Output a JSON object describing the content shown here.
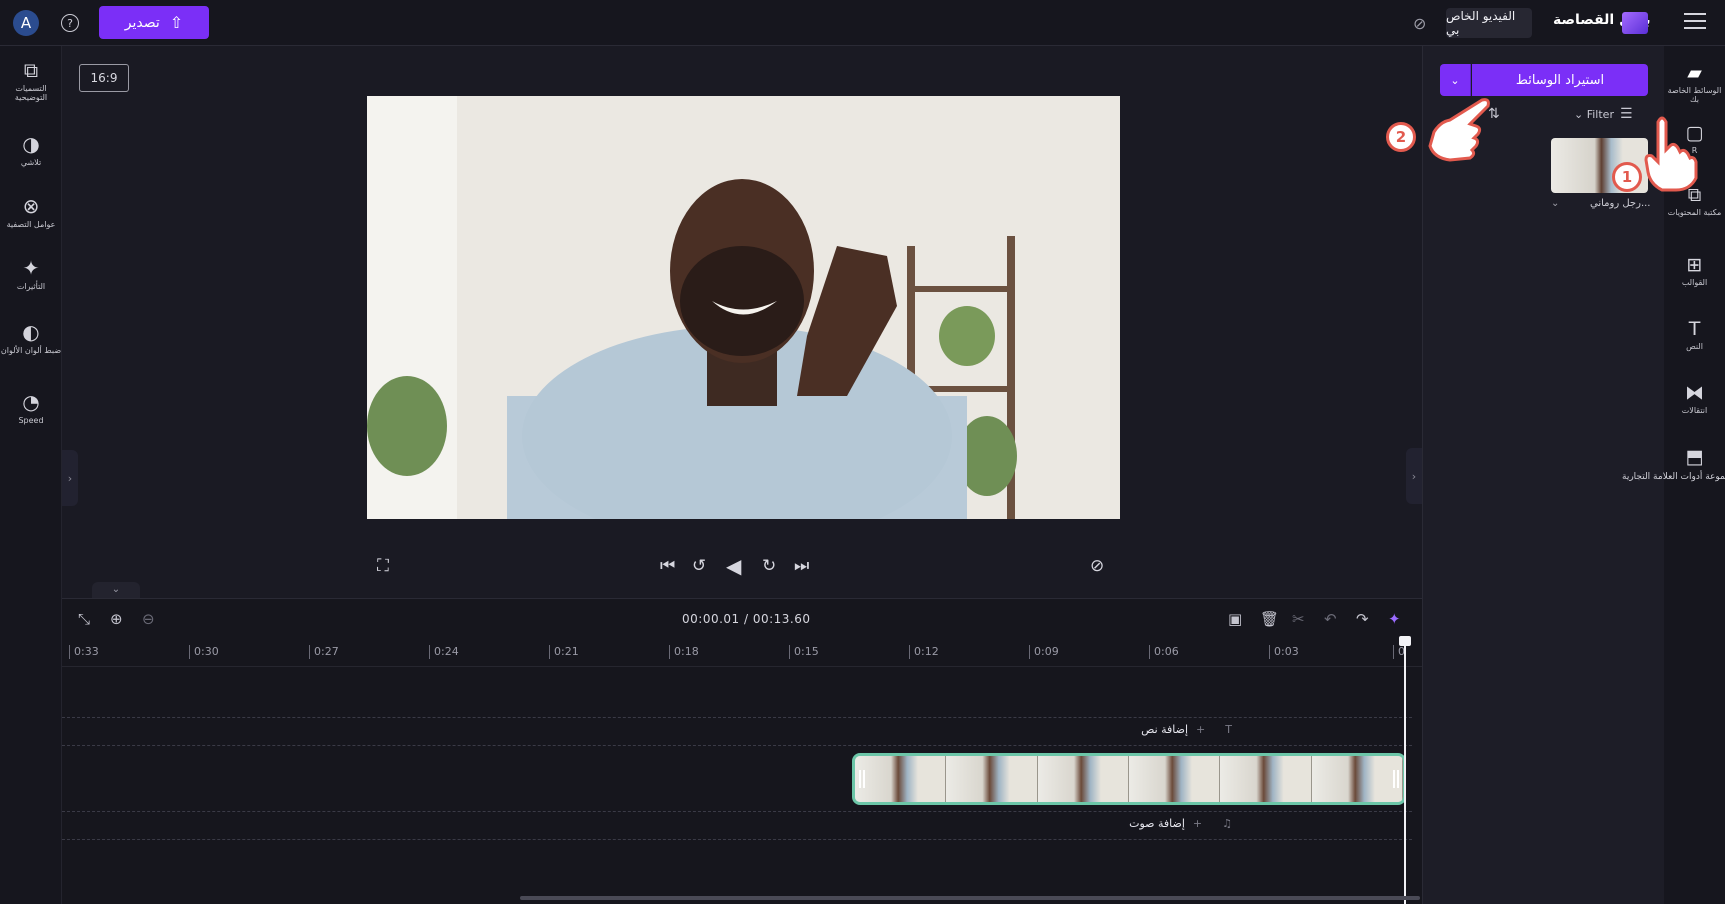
{
  "topbar": {
    "avatar_letter": "A",
    "help_label": "?",
    "export_label": "تصدير",
    "video_title": "الفيديو الخاص بي",
    "brand_name": "بطل القصاصة"
  },
  "left_tools": [
    {
      "label": "التسميات التوضيحية",
      "icon": "cc-icon"
    },
    {
      "label": "تلاشي",
      "icon": "fade-icon"
    },
    {
      "label": "عوامل التصفية",
      "icon": "filters-icon"
    },
    {
      "label": "التأثيرات",
      "icon": "effects-icon"
    },
    {
      "label": "ضبط ألوان الألوان",
      "icon": "color-adjust-icon"
    },
    {
      "label": "Speed",
      "icon": "speed-icon"
    }
  ],
  "preview": {
    "aspect_ratio": "16:9"
  },
  "timeline": {
    "timecode": "00:00.01 / 00:13.60",
    "ruler_ticks": [
      "0",
      "0:03",
      "0:06",
      "0:09",
      "0:12",
      "0:15",
      "0:18",
      "0:21",
      "0:24",
      "0:27",
      "0:30",
      "0:33"
    ],
    "add_text": "إضافة نص",
    "add_audio": "إضافة صوت"
  },
  "media_panel": {
    "import_label": "استيراد الوسائط",
    "filter_label": "Filter",
    "media_item_label": "رجل روماني..."
  },
  "right_tools": [
    {
      "label": "الوسائط الخاصة بك",
      "icon": "folder-icon"
    },
    {
      "label": "R",
      "icon": "record-icon"
    },
    {
      "label": "مكتبة المحتويات",
      "icon": "content-library-icon"
    },
    {
      "label": "القوالب",
      "icon": "templates-icon"
    },
    {
      "label": "النص",
      "icon": "text-icon"
    },
    {
      "label": "انتقالات",
      "icon": "transitions-icon"
    },
    {
      "label": "مجموعة أدوات العلامة التجارية",
      "icon": "brand-kit-icon"
    }
  ],
  "callouts": [
    "1",
    "2"
  ]
}
